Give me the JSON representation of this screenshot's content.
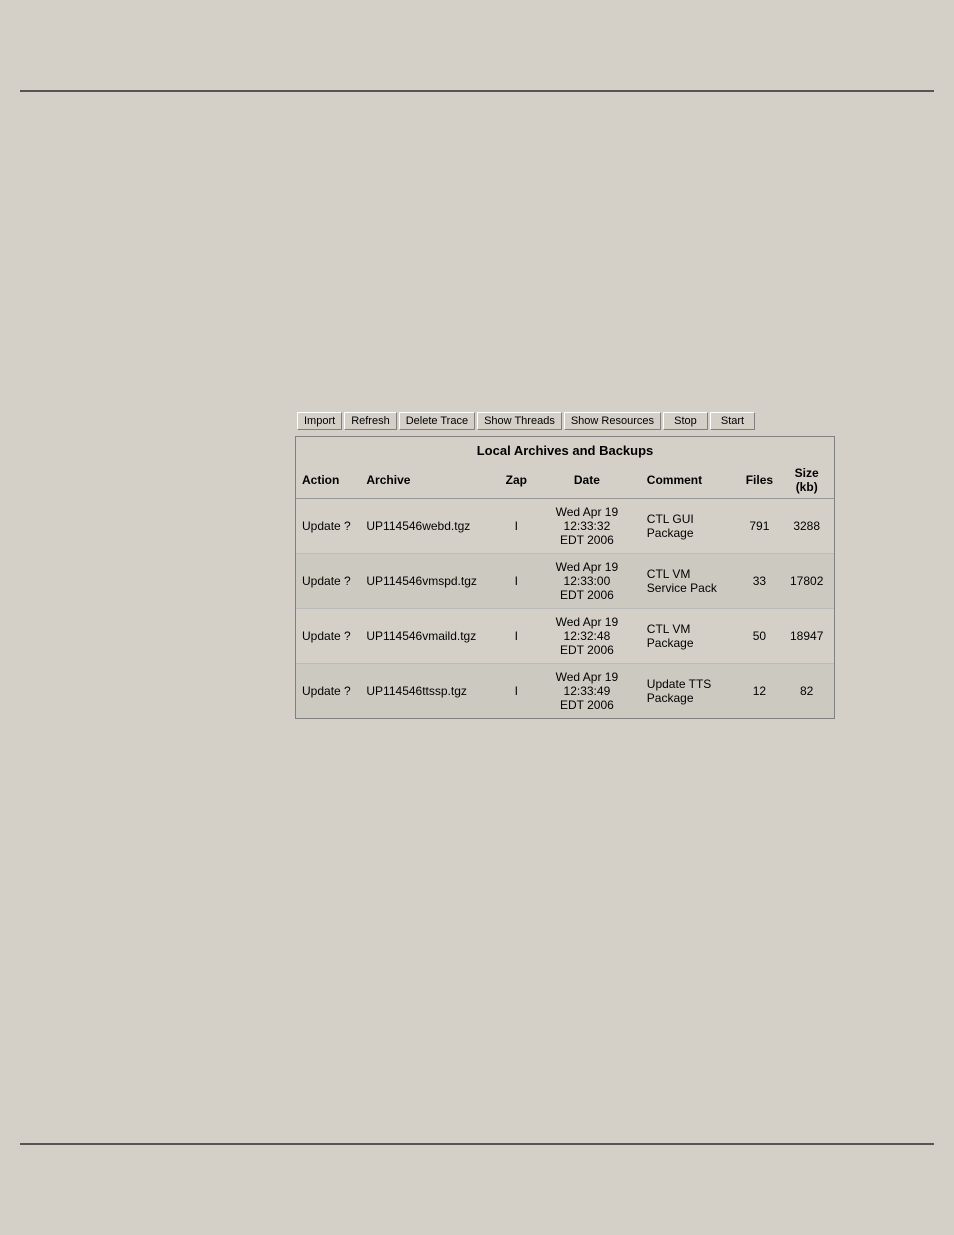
{
  "top_line": true,
  "bottom_line": true,
  "toolbar": {
    "buttons": [
      {
        "label": "Import",
        "name": "import-button"
      },
      {
        "label": "Refresh",
        "name": "refresh-button"
      },
      {
        "label": "Delete Trace",
        "name": "delete-trace-button"
      },
      {
        "label": "Show Threads",
        "name": "show-threads-button"
      },
      {
        "label": "Show Resources",
        "name": "show-resources-button"
      },
      {
        "label": "Stop",
        "name": "stop-button"
      },
      {
        "label": "Start",
        "name": "start-button"
      }
    ]
  },
  "table": {
    "title": "Local Archives and Backups",
    "columns": [
      {
        "label": "Action",
        "key": "action"
      },
      {
        "label": "Archive",
        "key": "archive"
      },
      {
        "label": "Zap",
        "key": "zap"
      },
      {
        "label": "Date",
        "key": "date"
      },
      {
        "label": "Comment",
        "key": "comment"
      },
      {
        "label": "Files",
        "key": "files"
      },
      {
        "label": "Size (kb)",
        "key": "size"
      }
    ],
    "rows": [
      {
        "action": "Update ?",
        "archive": "UP114546webd.tgz",
        "zap": "I",
        "date": "Wed Apr 19 12:33:32 EDT 2006",
        "comment": "CTL GUI Package",
        "files": "791",
        "size": "3288"
      },
      {
        "action": "Update ?",
        "archive": "UP114546vmspd.tgz",
        "zap": "I",
        "date": "Wed Apr 19 12:33:00 EDT 2006",
        "comment": "CTL VM Service Pack",
        "files": "33",
        "size": "17802"
      },
      {
        "action": "Update ?",
        "archive": "UP114546vmaild.tgz",
        "zap": "I",
        "date": "Wed Apr 19 12:32:48 EDT 2006",
        "comment": "CTL VM Package",
        "files": "50",
        "size": "18947"
      },
      {
        "action": "Update ?",
        "archive": "UP114546ttssp.tgz",
        "zap": "I",
        "date": "Wed Apr 19 12:33:49 EDT 2006",
        "comment": "Update TTS Package",
        "files": "12",
        "size": "82"
      }
    ]
  }
}
